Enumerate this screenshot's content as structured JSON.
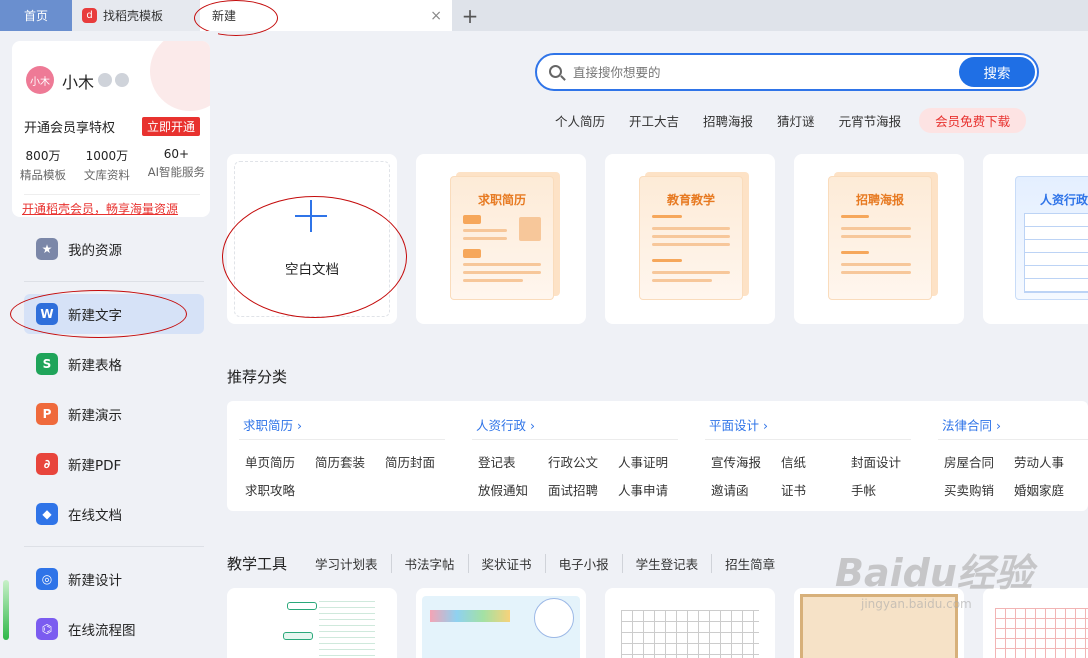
{
  "tabs": {
    "home": "首页",
    "templates": "找稻壳模板",
    "new": "新建",
    "close_icon": "×",
    "add_icon": "+"
  },
  "user": {
    "avatar_text": "小木",
    "name": "小木",
    "vip_prompt": "开通会员享特权",
    "vip_button": "立即开通",
    "stats": [
      {
        "num": "800万",
        "label": "精品模板"
      },
      {
        "num": "1000万",
        "label": "文库资料"
      },
      {
        "num": "60+",
        "label": "AI智能服务"
      }
    ],
    "promo": "开通稻壳会员，畅享海量资源"
  },
  "sidebar": {
    "items": [
      {
        "label": "我的资源",
        "icon": "star-icon",
        "color": "#7b87a8"
      },
      {
        "label": "新建文字",
        "icon": "writer-icon",
        "color": "#2f6fdb"
      },
      {
        "label": "新建表格",
        "icon": "spreadsheet-icon",
        "color": "#1fa45a"
      },
      {
        "label": "新建演示",
        "icon": "presentation-icon",
        "color": "#ef6a3c"
      },
      {
        "label": "新建PDF",
        "icon": "pdf-icon",
        "color": "#e8453c"
      },
      {
        "label": "在线文档",
        "icon": "cloud-doc-icon",
        "color": "#2f74e8"
      },
      {
        "label": "新建设计",
        "icon": "design-icon",
        "color": "#2f74e8"
      },
      {
        "label": "在线流程图",
        "icon": "flowchart-icon",
        "color": "#7b5cf0"
      }
    ]
  },
  "search": {
    "placeholder": "直接搜你想要的",
    "button": "搜索",
    "hotwords": [
      "个人简历",
      "开工大吉",
      "招聘海报",
      "猜灯谜",
      "元宵节海报"
    ],
    "vip_download": "会员免费下载"
  },
  "templates": {
    "blank": "空白文档",
    "cards": [
      "求职简历",
      "教育教学",
      "招聘海报",
      "人资行政"
    ]
  },
  "categories": {
    "title": "推荐分类",
    "groups": [
      {
        "head": "求职简历 ›",
        "items": [
          "单页简历",
          "简历套装",
          "简历封面",
          "求职攻略"
        ]
      },
      {
        "head": "人资行政 ›",
        "items": [
          "登记表",
          "行政公文",
          "人事证明",
          "放假通知",
          "面试招聘",
          "人事申请"
        ]
      },
      {
        "head": "平面设计 ›",
        "items": [
          "宣传海报",
          "信纸",
          "封面设计",
          "邀请函",
          "证书",
          "手帐"
        ]
      },
      {
        "head": "法律合同 ›",
        "items": [
          "房屋合同",
          "劳动人事",
          "买卖购销",
          "婚姻家庭"
        ]
      }
    ]
  },
  "teaching": {
    "title": "教学工具",
    "tabs": [
      "学习计划表",
      "书法字帖",
      "奖状证书",
      "电子小报",
      "学生登记表",
      "招生简章"
    ]
  },
  "watermark": {
    "main": "Baidu经验",
    "sub": "jingyan.baidu.com"
  },
  "colors": {
    "accent": "#2f74e8",
    "vip_red": "#e8322f",
    "annotation": "#c40b0b"
  }
}
